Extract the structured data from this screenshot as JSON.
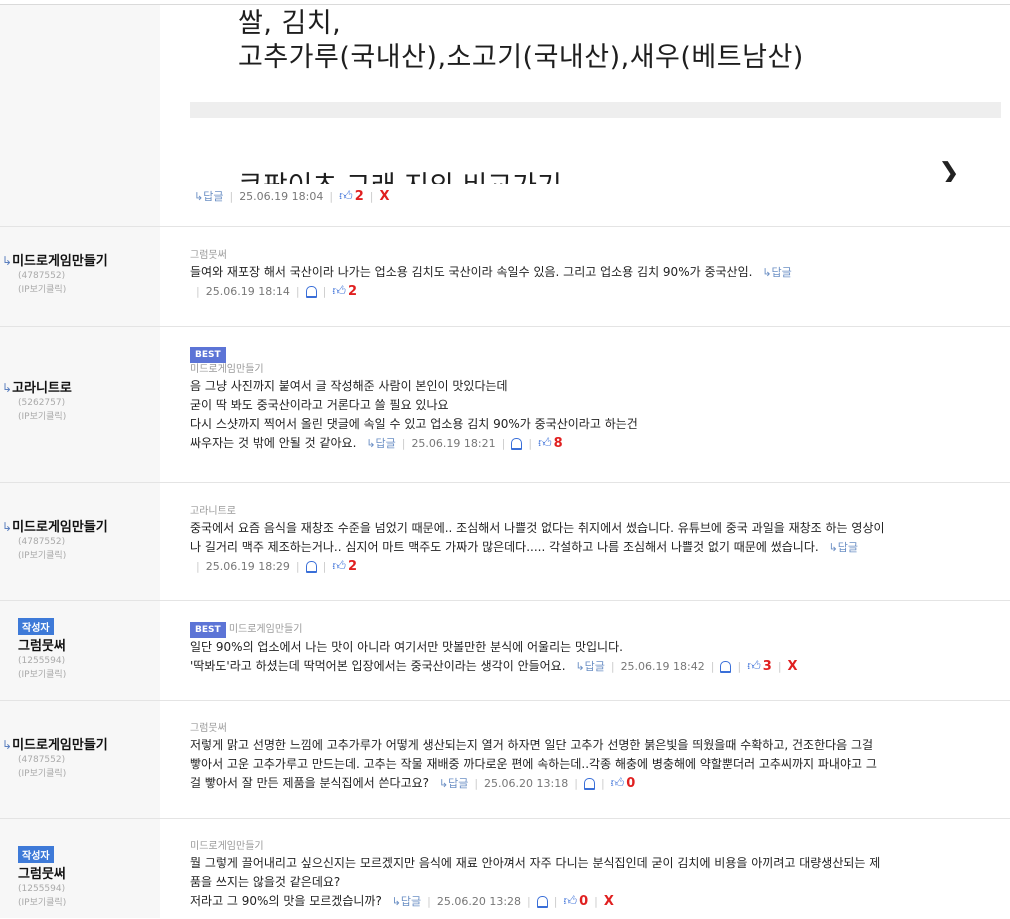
{
  "first_post": {
    "line1": "쌀, 김치,",
    "line2": "고추가루(국내산),소고기(국내산),새우(베트남산)",
    "line3": "쿠팡이츠 그래 지의 비교가기",
    "meta": {
      "reply": "↳답글",
      "date": "25.06.19 18:04",
      "likes": "2",
      "x": "X"
    }
  },
  "comments": [
    {
      "user": "미드로게임만들기",
      "user_id": "(4787552)",
      "ip": "(IP보기클릭)",
      "badge": "",
      "best": "",
      "target": "그럼뭇써",
      "lines": [
        "들여와 재포장 해서 국산이라 나가는 업소용 김치도 국산이라 속일수 있음. 그리고 업소용 김치 90%가 중국산임."
      ],
      "reply": "↳답글",
      "date": "25.06.19 18:14",
      "likes": "2",
      "x": ""
    },
    {
      "user": "고라니트로",
      "user_id": "(5262757)",
      "ip": "(IP보기클릭)",
      "badge": "",
      "best": "BEST",
      "target": "미드로게임만들기",
      "lines": [
        "음 그냥 사진까지 붙여서 글 작성해준 사람이 본인이 맛있다는데",
        "굳이 딱 봐도 중국산이라고 거론다고 쓸 필요 있나요",
        "다시 스샷까지 찍어서 올린 댓글에 속일 수 있고 업소용 김치 90%가 중국산이라고 하는건",
        "싸우자는 것 밖에 안될 것 같아요."
      ],
      "reply": "↳답글",
      "date": "25.06.19 18:21",
      "likes": "8",
      "x": ""
    },
    {
      "user": "미드로게임만들기",
      "user_id": "(4787552)",
      "ip": "(IP보기클릭)",
      "badge": "",
      "best": "",
      "target": "고라니트로",
      "lines": [
        "중국에서 요즘 음식을 재창조 수준을 넘었기 때문에.. 조심해서 나쁠것 없다는 취지에서 썼습니다.  유튜브에 중국 과일을 재창조 하는 영상이",
        "나 길거리 맥주 제조하는거나.. 심지어 마트 맥주도 가짜가 많은데다.....   각설하고  나름 조심해서 나쁠것 없기 때문에 썼습니다."
      ],
      "reply": "↳답글",
      "date": "25.06.19 18:29",
      "likes": "2",
      "x": ""
    },
    {
      "user": "그럼뭇써",
      "user_id": "(1255594)",
      "ip": "(IP보기클릭)",
      "badge": "작성자",
      "best": "BEST",
      "target": "미드로게임만들기",
      "lines": [
        "일단 90%의 업소에서 나는 맛이 아니라 여기서만 맛볼만한 분식에 어울리는 맛입니다.",
        "'딱봐도'라고 하셨는데 딱먹어본 입장에서는 중국산이라는 생각이 안들어요."
      ],
      "reply": "↳답글",
      "date": "25.06.19 18:42",
      "likes": "3",
      "x": "X"
    },
    {
      "user": "미드로게임만들기",
      "user_id": "(4787552)",
      "ip": "(IP보기클릭)",
      "badge": "",
      "best": "",
      "target": "그럼뭇써",
      "lines": [
        "저렇게 맑고 선명한 느낌에 고추가루가 어떻게 생산되는지 열거 하자면 일단 고추가 선명한 붉은빛을 띄웠을때 수확하고, 건조한다음 그걸",
        "빻아서 고운 고추가루고 만드는데. 고추는 작물 재배중 까다로운 편에 속하는데..각종 해충에 병충해에 약할뿐더러 고추씨까지 파내야고 그",
        "걸 빻아서 잘 만든 제품을 분식집에서 쓴다고요?"
      ],
      "reply": "↳답글",
      "date": "25.06.20 13:18",
      "likes": "0",
      "x": ""
    },
    {
      "user": "그럼뭇써",
      "user_id": "(1255594)",
      "ip": "(IP보기클릭)",
      "badge": "작성자",
      "best": "",
      "target": "미드로게임만들기",
      "lines": [
        "뭘 그렇게 끌어내리고 싶으신지는 모르겠지만 음식에 재료 안아껴서 자주 다니는 분식집인데 굳이 김치에 비용을 아끼려고 대량생산되는 제",
        "품을 쓰지는 않을것 같은데요?",
        "저라고 그 90%의 맛을 모르겠습니까?"
      ],
      "reply": "↳답글",
      "date": "25.06.20 13:28",
      "likes": "0",
      "x": "X"
    }
  ]
}
